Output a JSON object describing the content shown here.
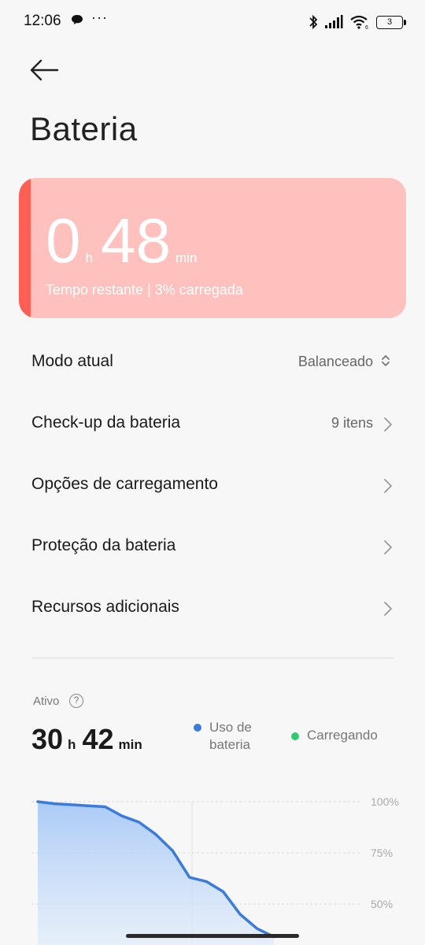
{
  "status_bar": {
    "time": "12:06",
    "dots": "···",
    "battery_level": "3"
  },
  "header": {
    "title": "Bateria"
  },
  "battery_card": {
    "hours": "0",
    "hours_unit": "h",
    "minutes": "48",
    "minutes_unit": "min",
    "subtitle": "Tempo restante | 3% carregada",
    "accent_color": "#ff5f55",
    "background_color": "#ffc1bd"
  },
  "menu": [
    {
      "label": "Modo atual",
      "value": "Balanceado",
      "indicator": "up-down-icon"
    },
    {
      "label": "Check-up da bateria",
      "value": "9 itens",
      "indicator": "chevron-right-icon"
    },
    {
      "label": "Opções de carregamento",
      "value": "",
      "indicator": "chevron-right-icon"
    },
    {
      "label": "Proteção da bateria",
      "value": "",
      "indicator": "chevron-right-icon"
    },
    {
      "label": "Recursos adicionais",
      "value": "",
      "indicator": "chevron-right-icon"
    }
  ],
  "active": {
    "label": "Ativo",
    "help": "?",
    "hours": "30",
    "hours_unit": "h",
    "minutes": "42",
    "minutes_unit": "min"
  },
  "legend": [
    {
      "label": "Uso de bateria",
      "color": "#3a7bdc"
    },
    {
      "label": "Carregando",
      "color": "#2ecc71"
    }
  ],
  "chart_data": {
    "type": "area",
    "y_ticks": [
      "100%",
      "75%",
      "50%"
    ],
    "ylim": [
      0,
      100
    ],
    "series": [
      {
        "name": "Uso de bateria",
        "values": [
          100,
          99,
          98.5,
          98,
          97.5,
          93,
          90,
          84,
          76,
          63,
          61,
          56,
          45,
          38,
          34
        ]
      }
    ]
  }
}
